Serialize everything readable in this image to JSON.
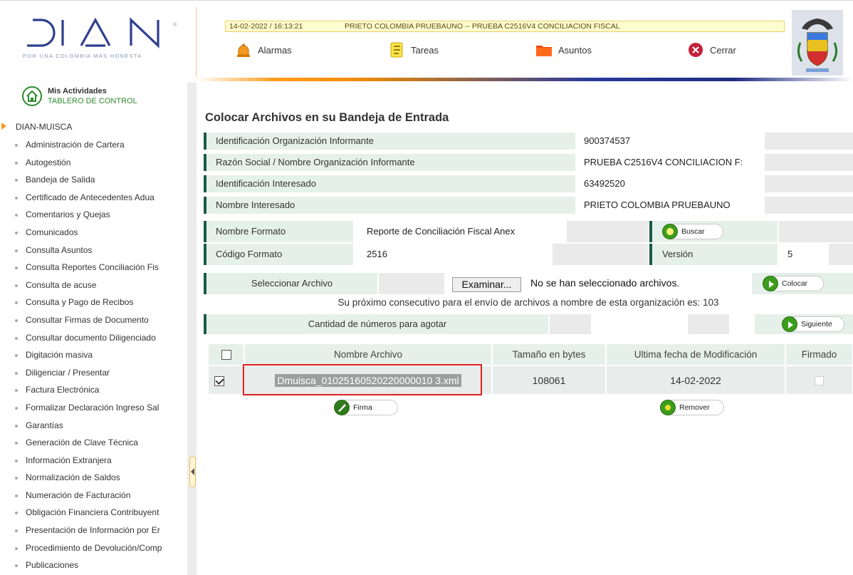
{
  "header": {
    "logo": {
      "wordmark": "DIAN",
      "tagline": "POR UNA COLOMBIA MÁS HONESTA",
      "registered": "®"
    },
    "status": {
      "datetime": "14-02-2022 / 16:13:21",
      "session": "PRIETO COLOMBIA PRUEBAUNO -- PRUEBA C2516V4 CONCILIACION FISCAL"
    },
    "nav": [
      {
        "label": "Alarmas",
        "icon": "bell-icon"
      },
      {
        "label": "Tareas",
        "icon": "task-list-icon"
      },
      {
        "label": "Asuntos",
        "icon": "folder-icon"
      },
      {
        "label": "Cerrar",
        "icon": "close-circle-icon"
      }
    ],
    "colors": {
      "accent_orange": "#f59a1e",
      "brand_green": "#1e5a46",
      "brand_blue": "#263a9e"
    }
  },
  "sidebar": {
    "title": "Mis Actividades",
    "subtitle": "TABLERO DE CONTROL",
    "group": "DIAN-MUISCA",
    "items": [
      "Administración de Cartera",
      "Autogestión",
      "Bandeja de Salida",
      "Certificado de Antecedentes Adua",
      "Comentarios y Quejas",
      "Comunicados",
      "Consulta Asuntos",
      "Consulta Reportes Conciliación Fis",
      "Consulta de acuse",
      "Consulta y Pago de Recibos",
      "Consultar Firmas de Documento",
      "Consultar documento Diligenciado",
      "Digitación masiva",
      "Diligenciar / Presentar",
      "Factura Electrónica",
      "Formalizar Declaración Ingreso Sal",
      "Garantías",
      "Generación de Clave Técnica",
      "Información Extranjera",
      "Normalización de Saldos",
      "Numeración de Facturación",
      "Obligación Financiera Contribuyent",
      "Presentación de Información por Er",
      "Procedimiento de Devolución/Comp",
      "Publicaciones"
    ]
  },
  "main": {
    "title": "Colocar Archivos en su Bandeja de Entrada",
    "info": [
      {
        "label": "Identificación Organización Informante",
        "value": "900374537"
      },
      {
        "label": "Razón Social / Nombre Organización Informante",
        "value": "PRUEBA C2516V4 CONCILIACION F:"
      },
      {
        "label": "Identificación Interesado",
        "value": "63492520"
      },
      {
        "label": "Nombre Interesado",
        "value": "PRIETO COLOMBIA PRUEBAUNO"
      }
    ],
    "formato": {
      "nombre_label": "Nombre Formato",
      "nombre_value": "Reporte de Conciliación Fiscal Anex",
      "buscar_label": "Buscar",
      "codigo_label": "Código Formato",
      "codigo_value": "2516",
      "version_label": "Versión",
      "version_value": "5"
    },
    "seleccionar": {
      "label": "Seleccionar Archivo",
      "browse_label": "Examinar...",
      "status": "No se han seleccionado archivos.",
      "colocar_label": "Colocar"
    },
    "consecutivo": "Su próximo consecutivo para el envío de archivos a nombre de esta organización es: 103",
    "cantidad": {
      "label": "Cantidad de números para agotar",
      "siguiente_label": "Siguiente"
    },
    "table": {
      "headers": [
        "Nombre Archivo",
        "Tamaño en bytes",
        "Ultima fecha de Modificación",
        "Firmado"
      ],
      "rows": [
        {
          "checked": true,
          "name": "Dmuisca_01025160520220000010 3.xml",
          "size": "108061",
          "modified": "14-02-2022",
          "signed": false
        }
      ]
    },
    "firma_label": "Firma",
    "remover_label": "Remover"
  }
}
